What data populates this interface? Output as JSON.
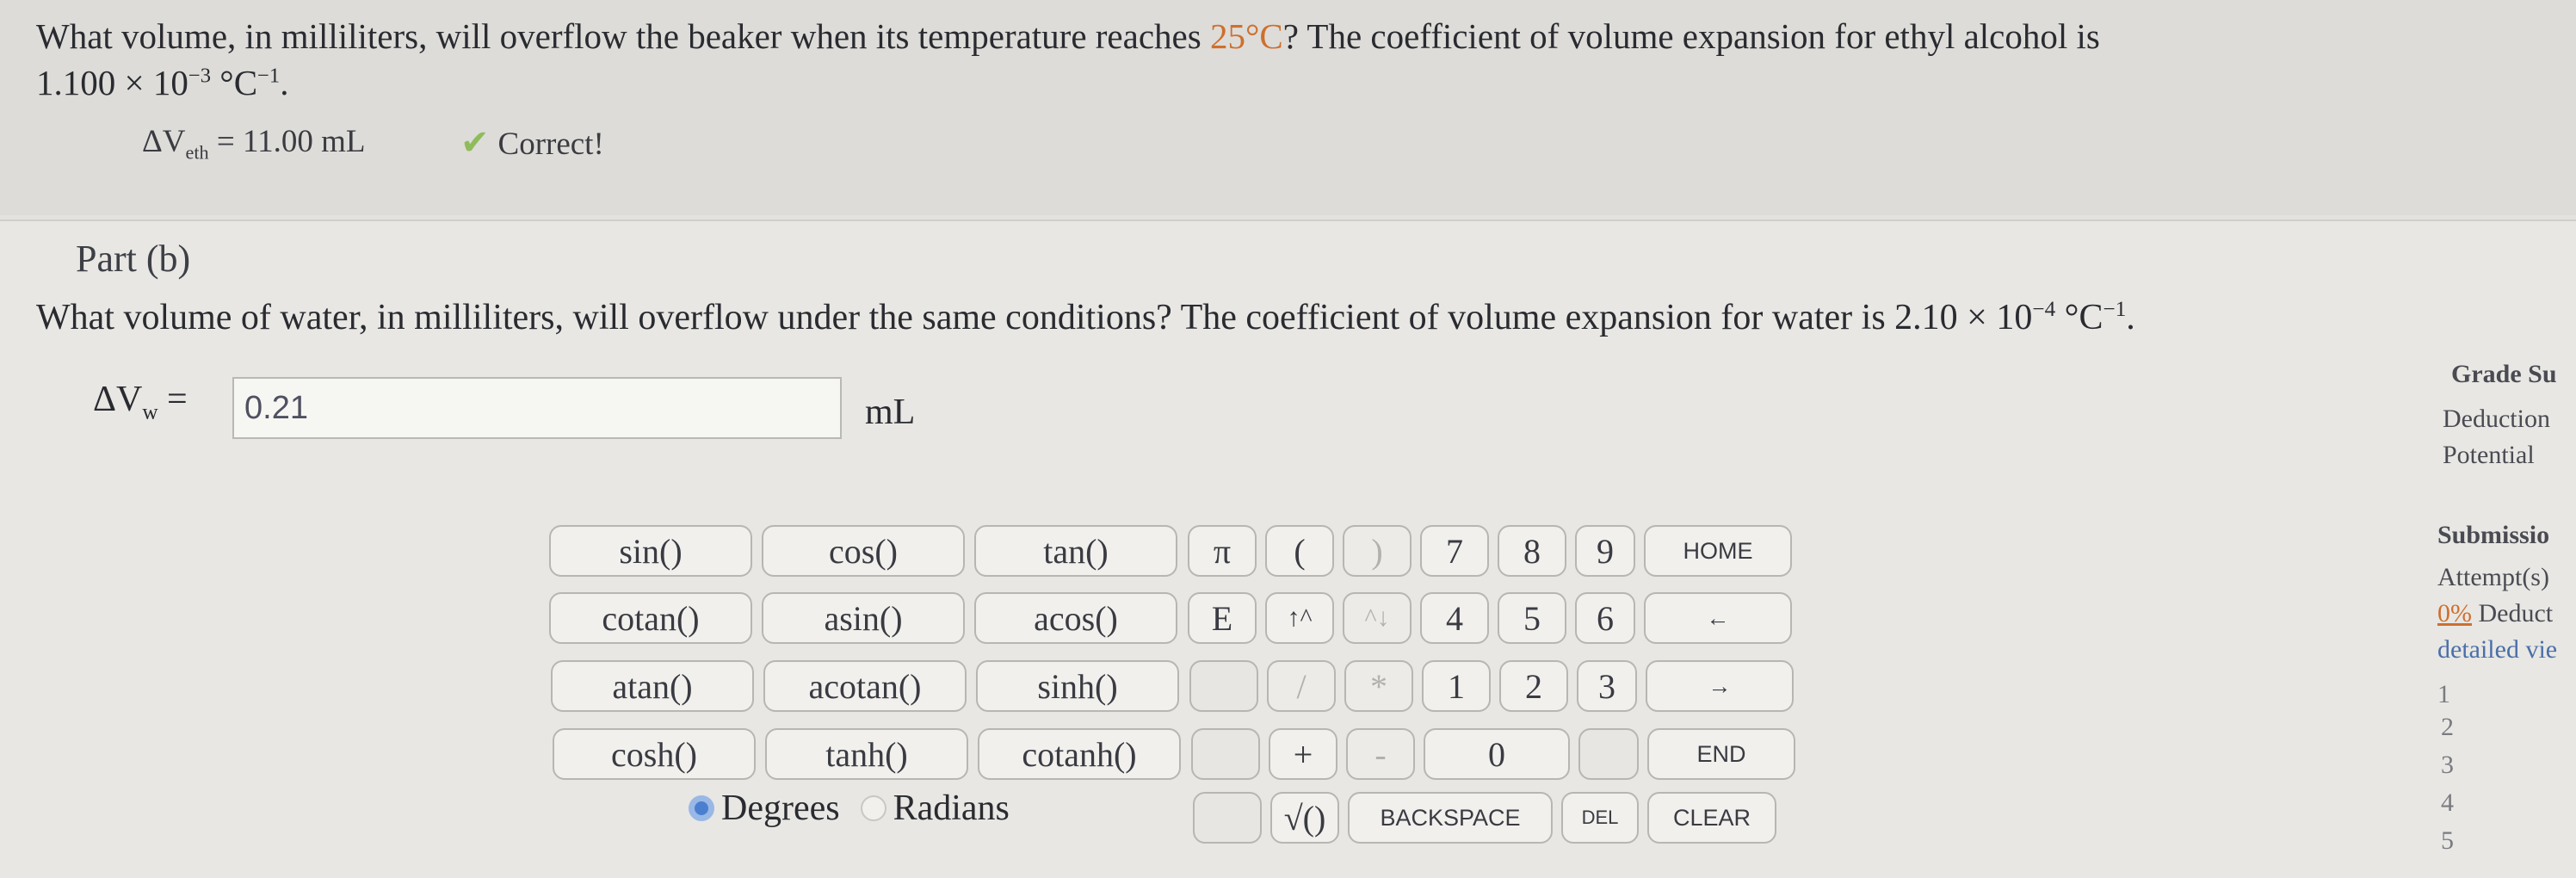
{
  "part_a": {
    "question_line1_pre": "What volume, in milliliters, will overflow the beaker when its temperature reaches ",
    "question_line1_temp": "25°C",
    "question_line1_post": "? The coefficient of volume expansion for ethyl alcohol is",
    "coef_mantissa": "1.100 × 10",
    "coef_exp": "−3",
    "coef_unit": " °C",
    "coef_unit_exp": "−1",
    "coef_end": ".",
    "answer_symbol": "ΔV",
    "answer_sub": "eth",
    "answer_value": " = 11.00 mL",
    "status": "Correct!"
  },
  "part_b": {
    "title": "Part (b)",
    "question_pre": "What volume of water, in milliliters, will overflow under the same conditions? The coefficient of volume expansion for water is 2.10 × 10",
    "question_exp": "−4",
    "question_unit": " °C",
    "question_unit_exp": "−1",
    "question_end": ".",
    "input_symbol": "ΔV",
    "input_sub": "w",
    "input_eq": " = ",
    "input_value": "0.21",
    "unit": "mL"
  },
  "calculator": {
    "functions": [
      "sin()",
      "cos()",
      "tan()",
      "cotan()",
      "asin()",
      "acos()",
      "atan()",
      "acotan()",
      "sinh()",
      "cosh()",
      "tanh()",
      "cotanh()"
    ],
    "symbols": [
      "π",
      "(",
      ")",
      "E",
      "↑^",
      "^↓",
      "/",
      "*",
      "+",
      "-",
      "√()"
    ],
    "digits": [
      "7",
      "8",
      "9",
      "4",
      "5",
      "6",
      "1",
      "2",
      "3",
      "0"
    ],
    "controls": [
      "HOME",
      "←",
      "→",
      "END",
      "BACKSPACE",
      "DEL",
      "CLEAR"
    ],
    "degrees_label": "Degrees",
    "radians_label": "Radians",
    "angle_mode": "Degrees"
  },
  "sidebar": {
    "grade_title": "Grade Su",
    "deduction": "Deduction",
    "potential": "Potential",
    "submissions_title": "Submissio",
    "attempts": "Attempt(s)",
    "deduct_pct": "0%",
    "deduct_text": " Deduct",
    "detailed": "detailed vie",
    "list_numbers": [
      "1",
      "2",
      "3",
      "4",
      "5"
    ]
  },
  "colors": {
    "accent": "#cf6f2d",
    "check": "#8fbc5a",
    "radio": "#4a7fd0"
  }
}
